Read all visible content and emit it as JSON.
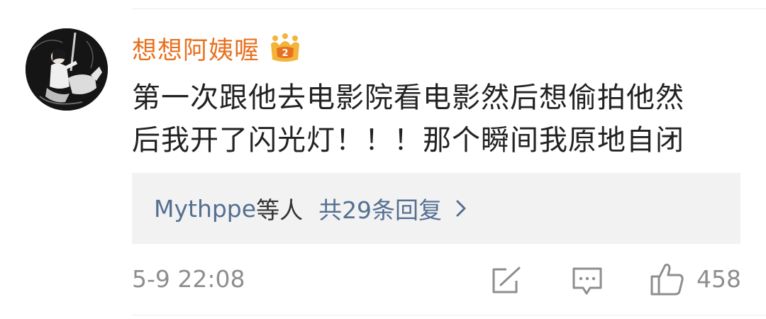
{
  "comment": {
    "username": "想想阿姨喔",
    "badge_icon": "crown-icon",
    "badge_colors": [
      "#f3b43a",
      "#e8711f"
    ],
    "text_lines": [
      "第一次跟他去电影院看电影然后想偷拍他然",
      "后我开了闪光灯！！！那个瞬间我原地自闭"
    ],
    "replies": {
      "users": "Mythppe",
      "users_suffix": "等人",
      "count_text": "共29条回复"
    },
    "timestamp": "5-9 22:08",
    "actions": {
      "share_icon": "share-icon",
      "comment_icon": "comment-icon",
      "like_icon": "thumbs-up-icon",
      "like_count": "458"
    }
  },
  "colors": {
    "username": "#e8711f",
    "link": "#556f92",
    "meta": "#8e8e8e",
    "text": "#222222",
    "replies_bg": "#f2f2f2"
  }
}
